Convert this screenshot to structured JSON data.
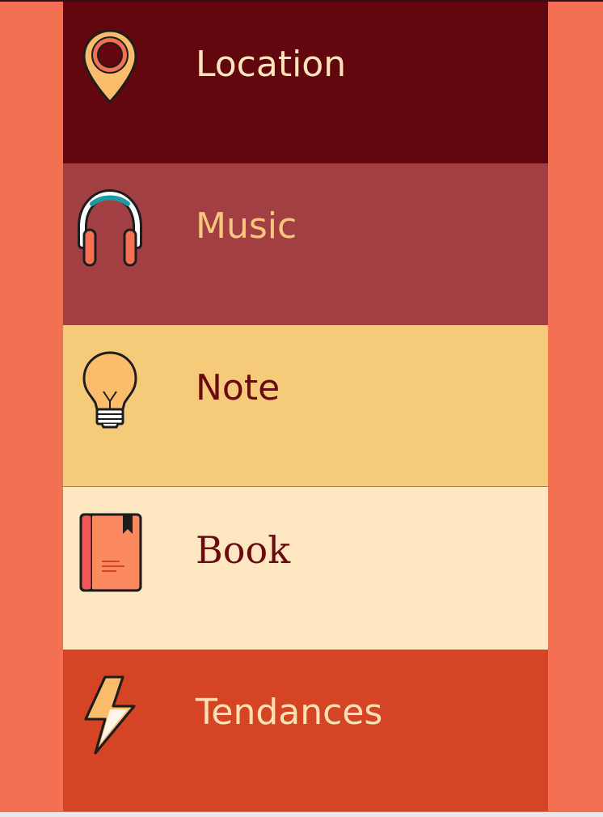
{
  "menu": {
    "items": [
      {
        "id": "location",
        "label": "Location",
        "icon": "location-pin-icon",
        "background": "#62070d",
        "text_color": "#ffe4bc"
      },
      {
        "id": "music",
        "label": "Music",
        "icon": "headphones-icon",
        "background": "#a23f43",
        "text_color": "#f8c77d"
      },
      {
        "id": "note",
        "label": "Note",
        "icon": "lightbulb-icon",
        "background": "#f5cb7a",
        "text_color": "#6b0a0e"
      },
      {
        "id": "book",
        "label": "Book",
        "icon": "book-icon",
        "background": "#ffe7c2",
        "text_color": "#6b0a0e"
      },
      {
        "id": "tendances",
        "label": "Tendances",
        "icon": "lightning-bolt-icon",
        "background": "#d44425",
        "text_color": "#ffe1b3"
      }
    ]
  },
  "colors": {
    "page_background": "#f47052",
    "outline": "#1d1d1d"
  }
}
